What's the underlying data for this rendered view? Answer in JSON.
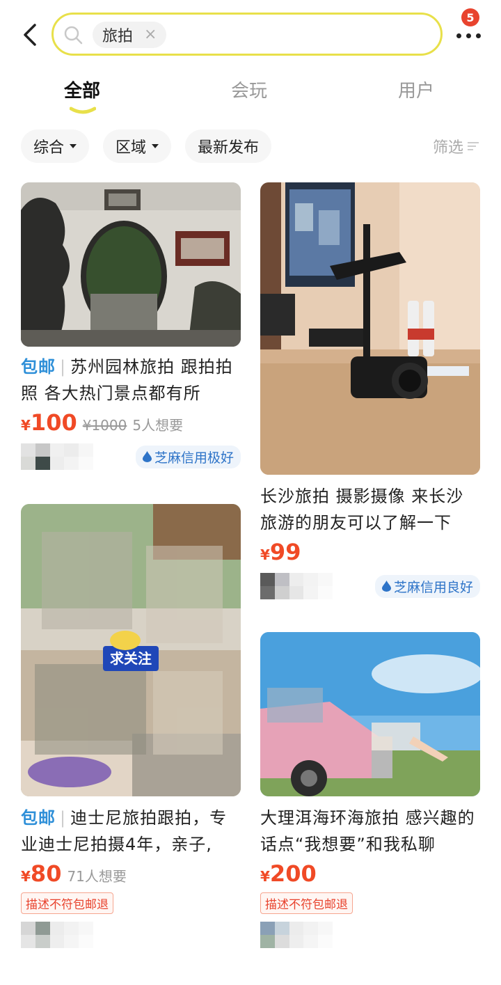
{
  "search": {
    "chip_label": "旅拍",
    "clear_label": "×"
  },
  "more": {
    "badge_count": "5"
  },
  "tabs": [
    {
      "label": "全部",
      "active": true
    },
    {
      "label": "会玩",
      "active": false
    },
    {
      "label": "用户",
      "active": false
    }
  ],
  "filters": {
    "sort_label": "综合",
    "region_label": "区域",
    "latest_label": "最新发布",
    "screen_label": "筛选"
  },
  "colors": {
    "accent": "#e8e04a",
    "price": "#f04a26",
    "free_tag": "#2e8fd8"
  },
  "items": [
    {
      "free_tag": "包邮",
      "title": "苏州园林旅拍 跟拍拍照 各大热门景点都有所",
      "currency": "¥",
      "price": "100",
      "original_price": "¥1000",
      "wants": "5人想要",
      "credit": "芝麻信用极好"
    },
    {
      "free_tag": "",
      "title": "长沙旅拍 摄影摄像 来长沙旅游的朋友可以了解一下",
      "currency": "¥",
      "price": "99",
      "credit": "芝麻信用良好"
    },
    {
      "free_tag": "包邮",
      "title": "迪士尼旅拍跟拍，专业迪士尼拍摄4年，亲子,",
      "currency": "¥",
      "price": "80",
      "wants": "71人想要",
      "badge": "描述不符包邮退",
      "image_text": "求关注"
    },
    {
      "free_tag": "",
      "title": "大理洱海环海旅拍 感兴趣的话点“我想要”和我私聊",
      "currency": "¥",
      "price": "200",
      "badge": "描述不符包邮退"
    }
  ]
}
